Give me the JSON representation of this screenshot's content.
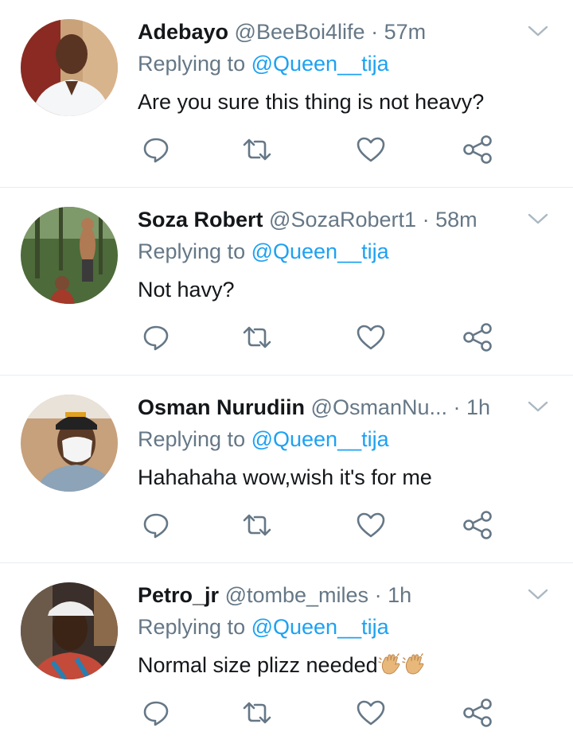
{
  "tweets": [
    {
      "name": "Adebayo",
      "handle": "@BeeBoi4life",
      "dot": "·",
      "time": "57m",
      "replying_prefix": "Replying to ",
      "replying_to": "@Queen__tija",
      "text": "Are you sure this thing is not heavy?"
    },
    {
      "name": "Soza Robert",
      "handle": "@SozaRobert1",
      "dot": "·",
      "time": "58m",
      "replying_prefix": "Replying to ",
      "replying_to": "@Queen__tija",
      "text": "Not havy?"
    },
    {
      "name": "Osman Nurudiin",
      "handle": "@OsmanNu...",
      "dot": "·",
      "time": "1h",
      "replying_prefix": "Replying to ",
      "replying_to": "@Queen__tija",
      "text": "Hahahaha wow,wish it's for me"
    },
    {
      "name": "Petro_jr",
      "handle": "@tombe_miles",
      "dot": "·",
      "time": "1h",
      "replying_prefix": "Replying to ",
      "replying_to": "@Queen__tija",
      "text": "Normal size plizz needed"
    }
  ],
  "icons": {
    "reply": "reply-icon",
    "retweet": "retweet-icon",
    "like": "heart-icon",
    "share": "share-icon",
    "more": "chevron-down-icon",
    "emoji": "waving-hand-emoji"
  },
  "colors": {
    "name": "#14171a",
    "muted": "#657786",
    "mention": "#1da1f2",
    "divider": "#e6ecf0",
    "icon": "#657786"
  }
}
